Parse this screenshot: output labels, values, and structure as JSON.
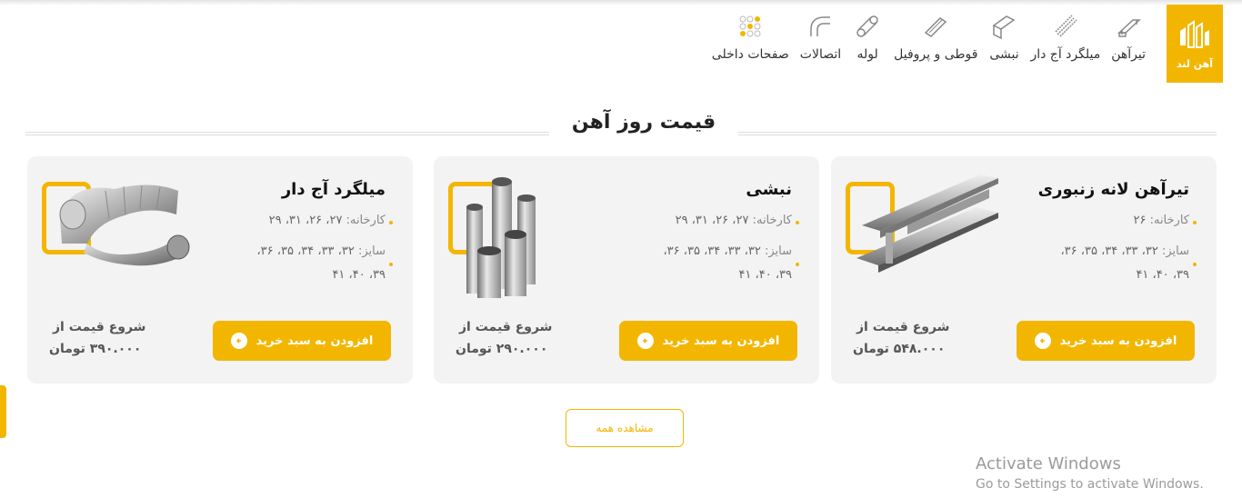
{
  "brand": {
    "name": "آهن لند",
    "color": "#f3b600"
  },
  "nav": [
    {
      "label": "تیرآهن",
      "icon": "i-beam-icon"
    },
    {
      "label": "میلگرد آج دار",
      "icon": "rebar-icon"
    },
    {
      "label": "نبشی",
      "icon": "angle-icon"
    },
    {
      "label": "قوطی و پروفیل",
      "icon": "profile-icon"
    },
    {
      "label": "لوله",
      "icon": "pipe-icon"
    },
    {
      "label": "اتصالات",
      "icon": "fitting-icon"
    },
    {
      "label": "صفحات داخلی",
      "icon": "pages-icon"
    }
  ],
  "section": {
    "title": "قیمت روز آهن"
  },
  "cards": [
    {
      "title": "تیرآهن لانه زنبوری",
      "factory_label": "کارخانه:",
      "factory_value": "۲۶",
      "size_label": "سایز:",
      "size_value": "۳۲، ۳۳، ۳۴، ۳۵، ۳۶،",
      "size_value2": "۳۹، ۴۰، ۴۱",
      "button": "افزودن به سبد خرید",
      "price_label": "شروع قیمت از",
      "price_value": "۵۴۸.۰۰۰ تومان",
      "image": "i-beam-image"
    },
    {
      "title": "نبشی",
      "factory_label": "کارخانه:",
      "factory_value": "۲۷، ۲۶، ۳۱، ۲۹",
      "size_label": "سایز:",
      "size_value": "۳۲، ۳۳، ۳۴، ۳۵، ۳۶،",
      "size_value2": "۳۹، ۴۰، ۴۱",
      "button": "افزودن به سبد خرید",
      "price_label": "شروع قیمت از",
      "price_value": "۲۹۰.۰۰۰ تومان",
      "image": "pipes-image"
    },
    {
      "title": "میلگرد آج دار",
      "factory_label": "کارخانه:",
      "factory_value": "۲۷، ۲۶، ۳۱، ۲۹",
      "size_label": "سایز:",
      "size_value": "۳۲، ۳۳، ۳۴، ۳۵، ۳۶،",
      "size_value2": "۳۹، ۴۰، ۴۱",
      "button": "افزودن به سبد خرید",
      "price_label": "شروع قیمت از",
      "price_value": "۳۹۰.۰۰۰ تومان",
      "image": "fitting-image"
    }
  ],
  "view_all": "مشاهده همه",
  "windows_watermark": {
    "title": "Activate Windows",
    "subtitle": "Go to Settings to activate Windows."
  }
}
